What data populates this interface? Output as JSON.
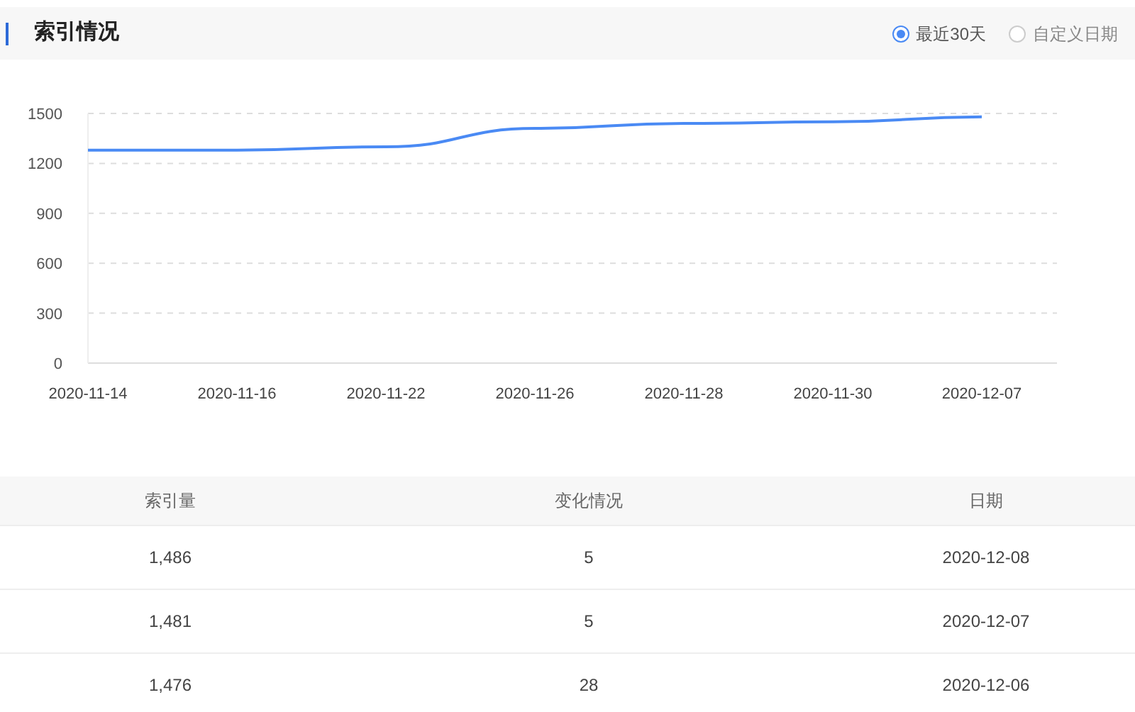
{
  "header": {
    "title": "索引情况",
    "range_options": [
      {
        "label": "最近30天",
        "selected": true
      },
      {
        "label": "自定义日期",
        "selected": false
      }
    ]
  },
  "chart": {
    "chart_data": {
      "type": "line",
      "grid": true,
      "categories": [
        "2020-11-14",
        "2020-11-16",
        "2020-11-22",
        "2020-11-26",
        "2020-11-28",
        "2020-11-30",
        "2020-12-07"
      ],
      "ylim": [
        0,
        1500
      ],
      "yticks": [
        0,
        300,
        600,
        900,
        1200,
        1500
      ],
      "series": [
        {
          "color": "#4a8af4",
          "values": [
            1280,
            1280,
            1300,
            1410,
            1440,
            1450,
            1480
          ]
        }
      ]
    }
  },
  "table": {
    "columns": [
      "索引量",
      "变化情况",
      "日期"
    ],
    "rows": [
      [
        "1,486",
        "5",
        "2020-12-08"
      ],
      [
        "1,481",
        "5",
        "2020-12-07"
      ],
      [
        "1,476",
        "28",
        "2020-12-06"
      ]
    ]
  }
}
